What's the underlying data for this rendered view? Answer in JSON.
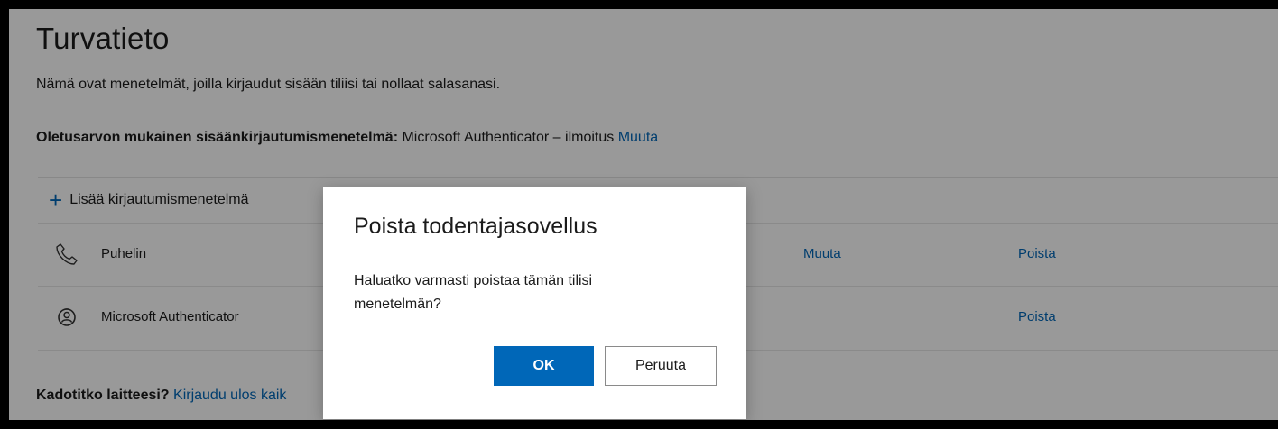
{
  "page": {
    "title": "Turvatieto",
    "subtitle": "Nämä ovat menetelmät, joilla kirjaudut sisään tiliisi tai nollaat salasanasi.",
    "default_method_label": "Oletusarvon mukainen sisäänkirjautumismenetelmä:",
    "default_method_value": " Microsoft Authenticator – ilmoitus ",
    "default_method_change": "Muuta",
    "add_method": "Lisää kirjautumismenetelmä",
    "methods": [
      {
        "name": "Puhelin",
        "icon": "phone-icon",
        "change": "Muuta",
        "remove": "Poista"
      },
      {
        "name": "Microsoft Authenticator",
        "icon": "authenticator-icon",
        "change": "",
        "remove": "Poista"
      }
    ],
    "lost_device_label": "Kadotitko laitteesi?",
    "lost_device_link": " Kirjaudu ulos kaik"
  },
  "dialog": {
    "title": "Poista todentajasovellus",
    "body": "Haluatko varmasti poistaa tämän tilisi menetelmän?",
    "ok": "OK",
    "cancel": "Peruuta"
  },
  "colors": {
    "accent": "#0067b8",
    "overlay": "rgba(0,0,0,0.40)"
  }
}
